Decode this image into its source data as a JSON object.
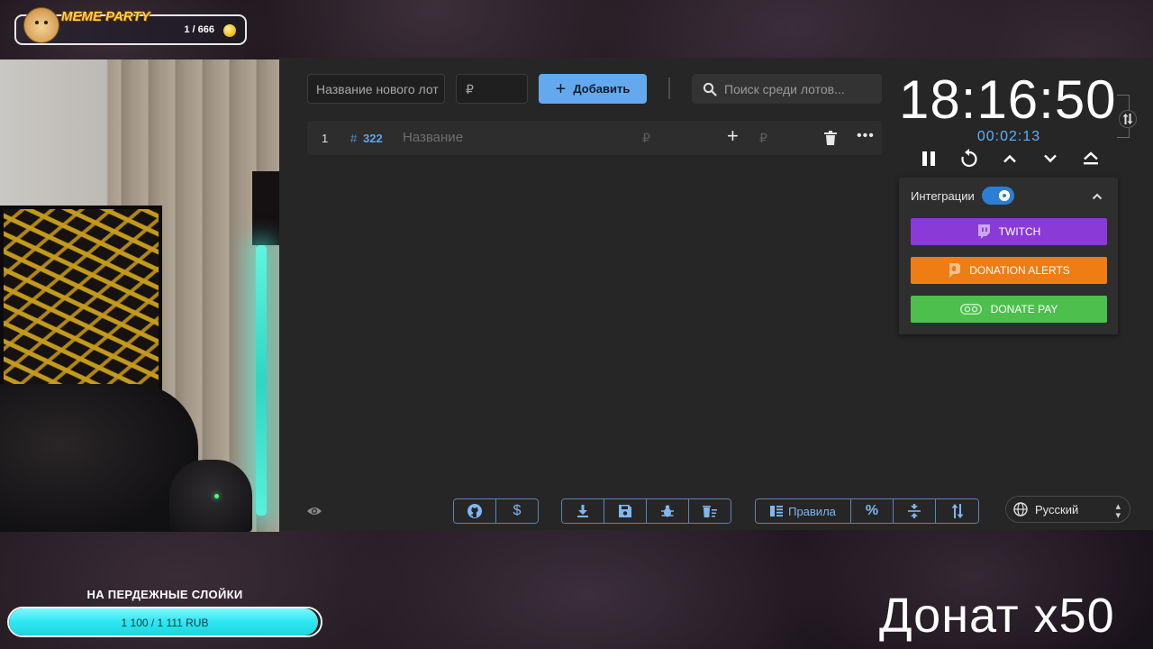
{
  "meme_party": {
    "title": "MEME PARTY",
    "count": "1 / 666"
  },
  "toolbar": {
    "lot_name_placeholder": "Название нового лот",
    "price_placeholder": "₽",
    "add_label": "Добавить",
    "search_placeholder": "Поиск среди лотов..."
  },
  "lots": [
    {
      "index": "1",
      "hash": "#",
      "id": "322",
      "name_placeholder": "Название",
      "currency": "₽",
      "add_symbol": "+",
      "currency_add": "₽"
    }
  ],
  "timer": {
    "main": "18:16:50",
    "elapsed": "00:02:13"
  },
  "integrations": {
    "title": "Интеграции",
    "enabled": true,
    "buttons": [
      {
        "label": "TWITCH",
        "color": "#8a3ad6"
      },
      {
        "label": "DONATION ALERTS",
        "color": "#f07c14"
      },
      {
        "label": "DONATE PAY",
        "color": "#4cbf4c"
      }
    ]
  },
  "bottom_bar": {
    "rules_label": "Правила",
    "language": "Русский"
  },
  "goal": {
    "title": "НА ПЕРДЕЖНЫЕ СЛОЙКИ",
    "progress_text": "1 100 / 1 111 RUB",
    "progress": 0.99
  },
  "overlay": {
    "text": "Донат x50"
  },
  "colors": {
    "accent": "#64a9ee",
    "timer_sub": "#5fb0ff",
    "goal_fill": "#2ce7f2"
  }
}
